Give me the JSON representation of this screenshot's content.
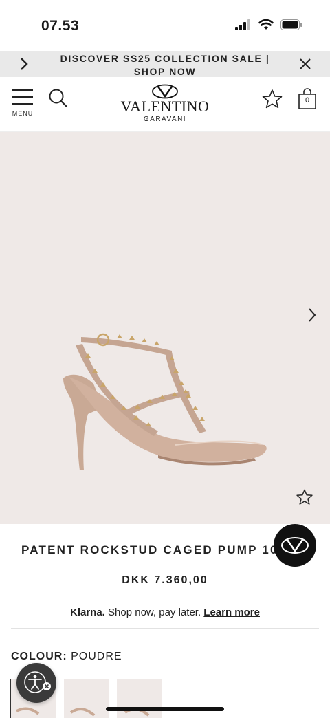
{
  "status_bar": {
    "time": "07.53"
  },
  "promo": {
    "text": "DISCOVER SS25 COLLECTION SALE | ",
    "link": "SHOP NOW"
  },
  "header": {
    "menu_label": "MENU",
    "brand_name": "VALENTINO",
    "brand_sub": "GARAVANI",
    "bag_count": "0"
  },
  "product": {
    "title": "PATENT ROCKSTUD CAGED PUMP 100MM",
    "price": "DKK 7.360,00",
    "klarna_brand": "Klarna.",
    "klarna_text": " Shop now, pay later. ",
    "klarna_link": "Learn more",
    "colour_label": "COLOUR:",
    "colour_value": " POUDRE"
  },
  "icons": {
    "promo_prev": "chevron-right-icon",
    "promo_close": "close-icon",
    "search": "search-icon",
    "wishlist": "star-icon",
    "bag": "bag-icon",
    "gallery_next": "chevron-right-icon",
    "chat": "valentino-v-logo-icon",
    "accessibility": "accessibility-icon"
  },
  "colors": {
    "promo_bg": "#e9e9e9",
    "gallery_bg": "#efe9e7",
    "shoe": "#c9a995",
    "stud": "#c9a56a"
  }
}
